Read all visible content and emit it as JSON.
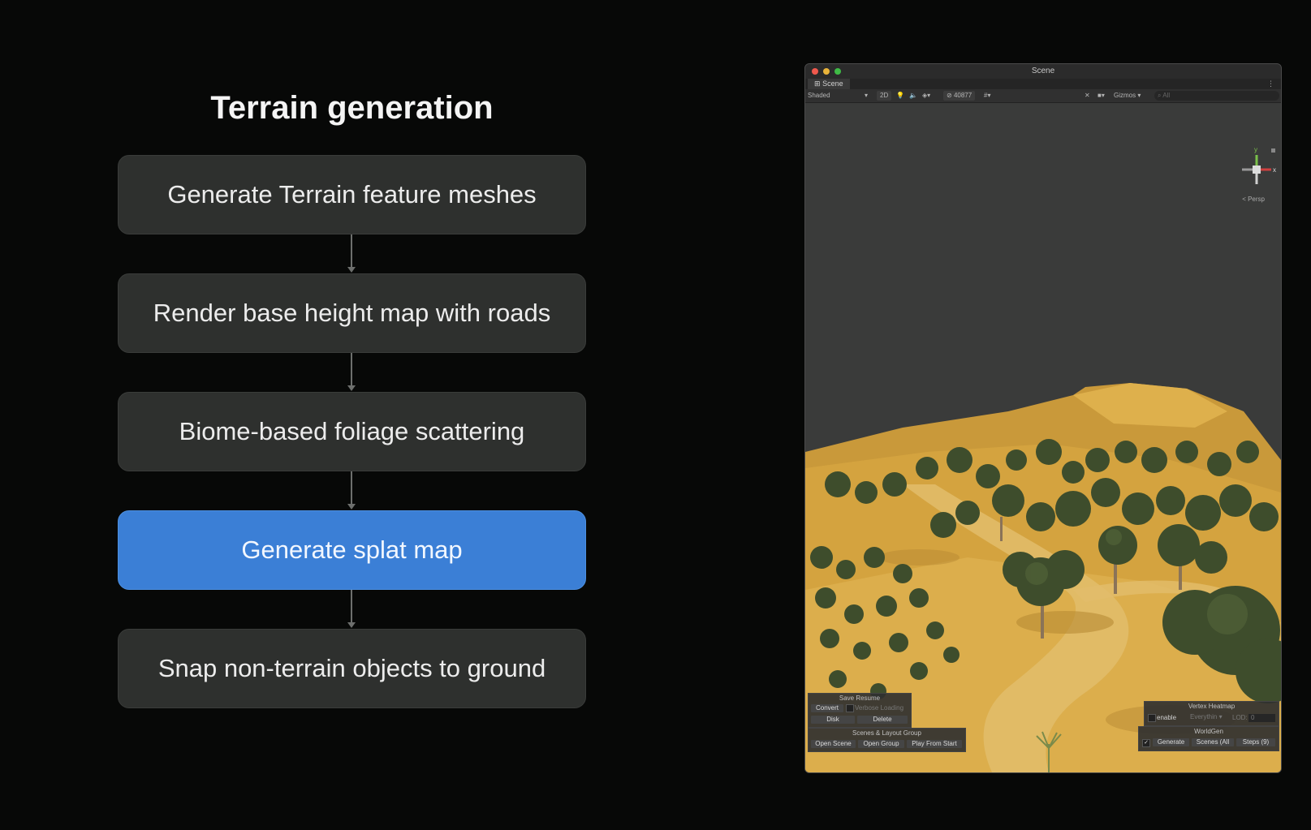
{
  "flow": {
    "title": "Terrain generation",
    "steps": [
      {
        "label": "Generate Terrain feature meshes",
        "active": false
      },
      {
        "label": "Render base height map with roads",
        "active": false
      },
      {
        "label": "Biome-based foliage scattering",
        "active": false
      },
      {
        "label": "Generate splat map",
        "active": true
      },
      {
        "label": "Snap non-terrain objects to ground",
        "active": false
      }
    ]
  },
  "window": {
    "title": "Scene",
    "tab_label": "Scene",
    "tab_menu": "⋮",
    "toolbar": {
      "shading_mode": "Shaded",
      "mode_2d": "2D",
      "hidden_count": "40877",
      "gizmos_label": "Gizmos",
      "search_placeholder": "All"
    },
    "orientation": {
      "y_label": "y",
      "x_label": "x",
      "view_label": "< Persp"
    },
    "save_resume": {
      "title": "Save Resume",
      "convert": "Convert",
      "verbose": "Verbose Loading",
      "disk": "Disk",
      "delete": "Delete"
    },
    "scenes_group": {
      "title": "Scenes & Layout Group",
      "open_scene": "Open Scene",
      "open_group": "Open Group",
      "play_from_start": "Play From Start"
    },
    "vertex_heatmap": {
      "title": "Vertex Heatmap",
      "enable": "enable",
      "everything": "Everythin",
      "lod_label": "LOD:",
      "lod_value": "0"
    },
    "worldgen": {
      "title": "WorldGen",
      "checkbox": "✓",
      "generate": "Generate",
      "scenes": "Scenes (All",
      "steps": "Steps (9)"
    }
  },
  "colors": {
    "active_step": "#3b7fd6",
    "step_bg": "#2e302e",
    "terrain_sand": "#d9a93e",
    "tree_green": "#3f4f2d"
  }
}
